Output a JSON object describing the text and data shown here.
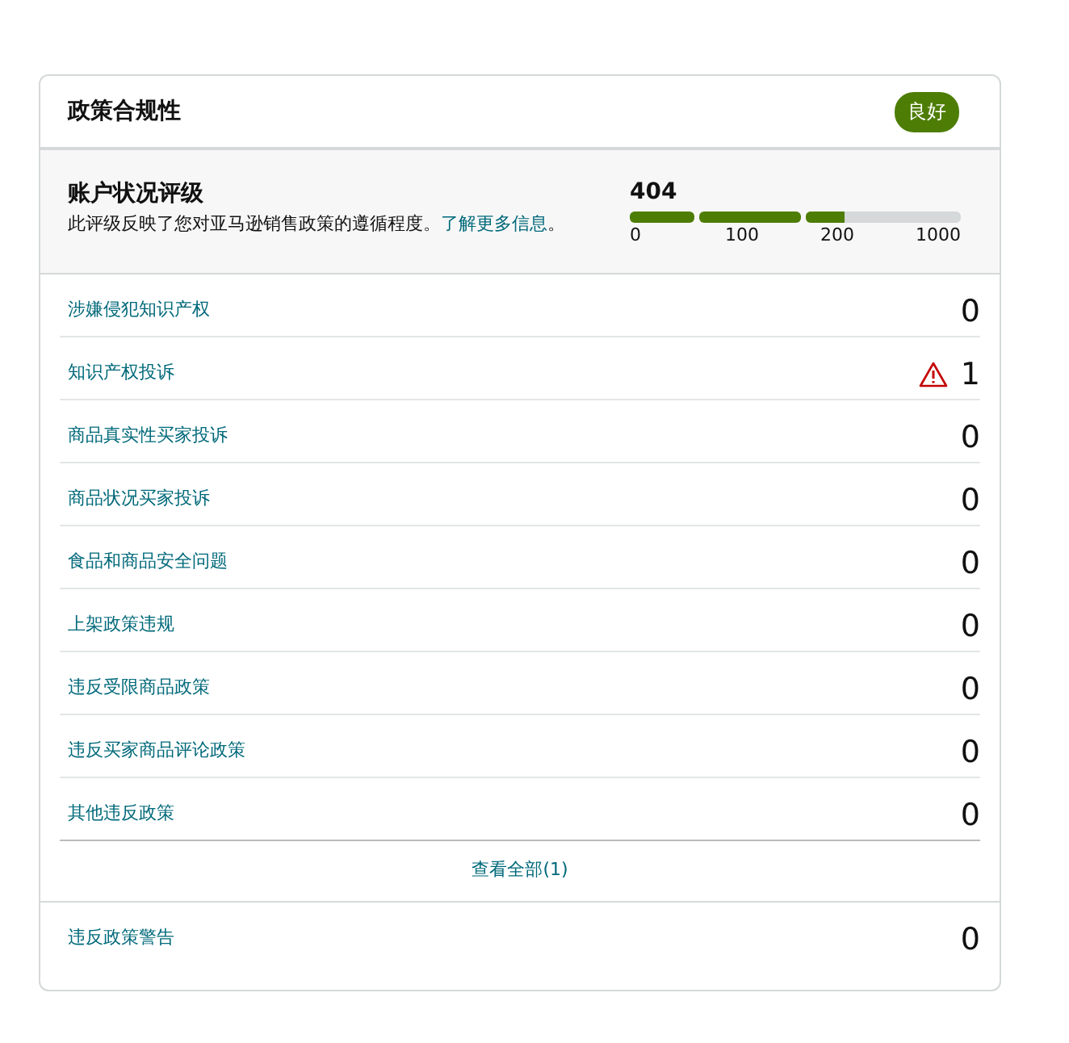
{
  "card": {
    "title": "政策合规性",
    "status_badge": "良好"
  },
  "health": {
    "title": "账户状况评级",
    "description": "此评级反映了您对亚马逊销售政策的遵循程度。",
    "link": "了解更多信息",
    "suffix": "。",
    "score": "404",
    "segments": [
      {
        "level": 1
      },
      {
        "level": 1
      },
      {
        "level": 0.25
      }
    ],
    "ticks": [
      "0",
      "100",
      "200",
      "1000"
    ]
  },
  "violations": [
    {
      "label": "涉嫌侵犯知识产权",
      "count": "0",
      "warning": false
    },
    {
      "label": "知识产权投诉",
      "count": "1",
      "warning": true
    },
    {
      "label": "商品真实性买家投诉",
      "count": "0",
      "warning": false
    },
    {
      "label": "商品状况买家投诉",
      "count": "0",
      "warning": false
    },
    {
      "label": "食品和商品安全问题",
      "count": "0",
      "warning": false
    },
    {
      "label": "上架政策违规",
      "count": "0",
      "warning": false
    },
    {
      "label": "违反受限商品政策",
      "count": "0",
      "warning": false
    },
    {
      "label": "违反买家商品评论政策",
      "count": "0",
      "warning": false
    },
    {
      "label": "其他违反政策",
      "count": "0",
      "warning": false
    }
  ],
  "view_all": "查看全部(1)",
  "warnings_row": {
    "label": "违反政策警告",
    "count": "0"
  }
}
